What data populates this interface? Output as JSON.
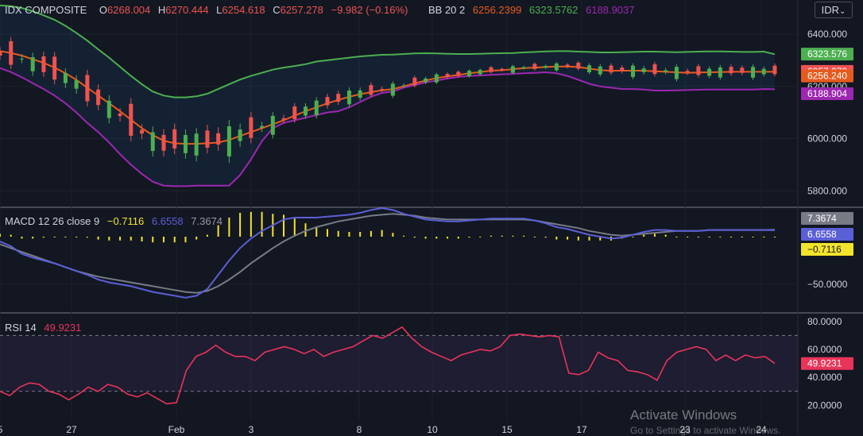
{
  "header": {
    "symbol": "IDX COMPOSITE",
    "open_label": "O",
    "open": "6268.004",
    "high_label": "H",
    "high": "6270.444",
    "low_label": "L",
    "low": "6254.618",
    "close_label": "C",
    "close": "6257.278",
    "change": "−9.982 (−0.16%)",
    "bb_label": "BB 20 2",
    "bb_basis": "6256.2399",
    "bb_upper": "6323.5762",
    "bb_lower": "6188.9037",
    "currency": "IDR",
    "currency_icon": "chevron-down-icon"
  },
  "macd_header": {
    "label": "MACD 12 26 close 9",
    "hist": "−0.7116",
    "macd": "6.6558",
    "signal": "7.3674"
  },
  "rsi_header": {
    "label": "RSI 14",
    "value": "49.9231"
  },
  "price_axis": [
    "6400.000",
    "6200.000",
    "6000.000",
    "5800.000"
  ],
  "price_badges": [
    {
      "text": "6323.576",
      "color": "#4caf50"
    },
    {
      "text": "6257.278",
      "color": "#ef5350"
    },
    {
      "text": "6256.240",
      "color": "#e65a1e"
    },
    {
      "text": "6188.904",
      "color": "#9c27b0"
    }
  ],
  "macd_axis": [
    "−50.0000"
  ],
  "macd_badges": [
    {
      "text": "7.3674",
      "color": "#787b86"
    },
    {
      "text": "6.6558",
      "color": "#5b5fd6"
    },
    {
      "text": "−0.7116",
      "color": "#f2e42b"
    }
  ],
  "rsi_axis": [
    "80.0000",
    "60.0000",
    "40.0000",
    "20.0000"
  ],
  "rsi_badge": {
    "text": "49.9231",
    "color": "#e8345a"
  },
  "x_labels": [
    "5",
    "27",
    "Feb",
    "3",
    "8",
    "10",
    "15",
    "17",
    "23",
    "24"
  ],
  "watermark": {
    "line1": "Activate Windows",
    "line2": "Go to Settings to activate Windows."
  },
  "colors": {
    "up": "#4caf50",
    "down": "#ef5350",
    "upper": "#4caf50",
    "basis": "#e65a1e",
    "lower": "#9c27b0",
    "macd": "#5b5fd6",
    "signal": "#787b86",
    "hist": "#f2e42b",
    "rsi": "#e8345a"
  },
  "chart_data": {
    "type": "line",
    "title": "IDX COMPOSITE",
    "panes": [
      "price",
      "macd",
      "rsi"
    ],
    "price": {
      "ylim": [
        5740,
        6470
      ],
      "bb_upper": [
        6510,
        6507,
        6500,
        6488,
        6472,
        6455,
        6432,
        6405,
        6375,
        6342,
        6310,
        6275,
        6240,
        6208,
        6180,
        6165,
        6158,
        6158,
        6162,
        6172,
        6190,
        6208,
        6226,
        6240,
        6252,
        6264,
        6272,
        6278,
        6285,
        6295,
        6300,
        6305,
        6310,
        6315,
        6318,
        6321,
        6322,
        6324,
        6326,
        6327,
        6326,
        6325,
        6324,
        6324,
        6325,
        6326,
        6327,
        6328,
        6330,
        6332,
        6334,
        6335,
        6335,
        6333,
        6332,
        6330,
        6330,
        6331,
        6332,
        6333,
        6333,
        6332,
        6331,
        6332,
        6333,
        6334,
        6334,
        6333,
        6332,
        6332,
        6333,
        6323
      ],
      "bb_basis": [
        6335,
        6328,
        6318,
        6304,
        6290,
        6272,
        6250,
        6225,
        6195,
        6165,
        6135,
        6105,
        6072,
        6040,
        6013,
        5992,
        5982,
        5980,
        5980,
        5982,
        5985,
        5995,
        6010,
        6025,
        6040,
        6055,
        6070,
        6088,
        6105,
        6120,
        6135,
        6148,
        6160,
        6170,
        6178,
        6185,
        6190,
        6200,
        6212,
        6222,
        6232,
        6238,
        6244,
        6250,
        6255,
        6260,
        6262,
        6266,
        6270,
        6272,
        6274,
        6276,
        6276,
        6274,
        6268,
        6262,
        6260,
        6260,
        6260,
        6260,
        6258,
        6256,
        6254,
        6252,
        6253,
        6254,
        6255,
        6256,
        6256,
        6256,
        6256,
        6256
      ],
      "bb_lower": [
        6270,
        6255,
        6235,
        6212,
        6190,
        6165,
        6135,
        6100,
        6060,
        6025,
        5985,
        5940,
        5900,
        5865,
        5835,
        5820,
        5818,
        5818,
        5820,
        5820,
        5820,
        5820,
        5860,
        5920,
        5990,
        6040,
        6060,
        6070,
        6080,
        6090,
        6100,
        6105,
        6120,
        6140,
        6160,
        6175,
        6180,
        6195,
        6205,
        6215,
        6222,
        6230,
        6236,
        6240,
        6242,
        6244,
        6246,
        6248,
        6250,
        6252,
        6254,
        6250,
        6240,
        6225,
        6210,
        6200,
        6195,
        6190,
        6190,
        6188,
        6184,
        6184,
        6185,
        6186,
        6187,
        6188,
        6188,
        6188,
        6188,
        6188,
        6190,
        6189
      ]
    },
    "macd": {
      "ylim": [
        -75,
        30
      ],
      "macd": [
        -5,
        -10,
        -18,
        -22,
        -25,
        -28,
        -32,
        -36,
        -40,
        -45,
        -48,
        -50,
        -52,
        -55,
        -58,
        -60,
        -62,
        -64,
        -62,
        -55,
        -40,
        -25,
        -12,
        -2,
        6,
        12,
        18,
        20,
        20,
        20,
        21,
        22,
        23,
        25,
        28,
        30,
        28,
        24,
        21,
        18,
        17,
        16,
        16,
        17,
        18,
        19,
        19,
        19,
        19,
        17,
        14,
        10,
        8,
        5,
        2,
        0,
        -2,
        -1,
        2,
        5,
        7,
        7,
        6,
        6,
        6,
        7,
        7,
        7,
        7,
        7,
        7,
        6.6558
      ],
      "signal": [
        -8,
        -12,
        -16,
        -20,
        -24,
        -28,
        -32,
        -36,
        -39,
        -42,
        -44,
        -46,
        -48,
        -50,
        -52,
        -54,
        -56,
        -58,
        -59,
        -57,
        -52,
        -45,
        -37,
        -28,
        -20,
        -12,
        -5,
        1,
        6,
        10,
        13,
        16,
        18,
        20,
        22,
        23,
        24,
        23,
        22,
        20,
        19,
        18,
        18,
        18,
        18,
        18,
        18,
        18,
        18,
        17,
        15,
        13,
        11,
        9,
        6,
        4,
        2,
        1,
        2,
        3,
        4,
        5,
        6,
        6,
        6,
        7,
        7,
        7,
        7,
        7,
        7,
        7.3674
      ],
      "hist": [
        3,
        2,
        -2,
        -2,
        -1,
        0,
        0,
        0,
        -1,
        -3,
        -4,
        -4,
        -4,
        -5,
        -6,
        -6,
        -6,
        -6,
        -3,
        2,
        12,
        20,
        25,
        26,
        26,
        24,
        23,
        19,
        14,
        10,
        8,
        6,
        5,
        5,
        6,
        7,
        4,
        1,
        -1,
        -2,
        -2,
        -2,
        -2,
        -1,
        0,
        1,
        1,
        1,
        1,
        0,
        -1,
        -3,
        -3,
        -4,
        -4,
        -4,
        -4,
        -2,
        0,
        2,
        3,
        2,
        0,
        0,
        0,
        0,
        0,
        0,
        0,
        0,
        0,
        -0.7116
      ]
    },
    "rsi": {
      "ylim": [
        10,
        85
      ],
      "bands": [
        30,
        70
      ],
      "values": [
        30,
        27,
        33,
        36,
        35,
        30,
        28,
        24,
        28,
        33,
        30,
        35,
        33,
        28,
        26,
        29,
        25,
        21,
        22,
        45,
        55,
        58,
        63,
        58,
        55,
        55,
        52,
        58,
        60,
        62,
        60,
        57,
        60,
        55,
        58,
        60,
        62,
        66,
        70,
        68,
        72,
        76,
        68,
        62,
        58,
        55,
        52,
        56,
        58,
        60,
        59,
        62,
        70,
        71,
        70,
        69,
        70,
        69,
        43,
        42,
        45,
        58,
        54,
        52,
        45,
        44,
        42,
        38,
        52,
        58,
        60,
        62,
        60,
        52,
        56,
        52,
        56,
        54,
        55,
        49.9231
      ]
    }
  }
}
